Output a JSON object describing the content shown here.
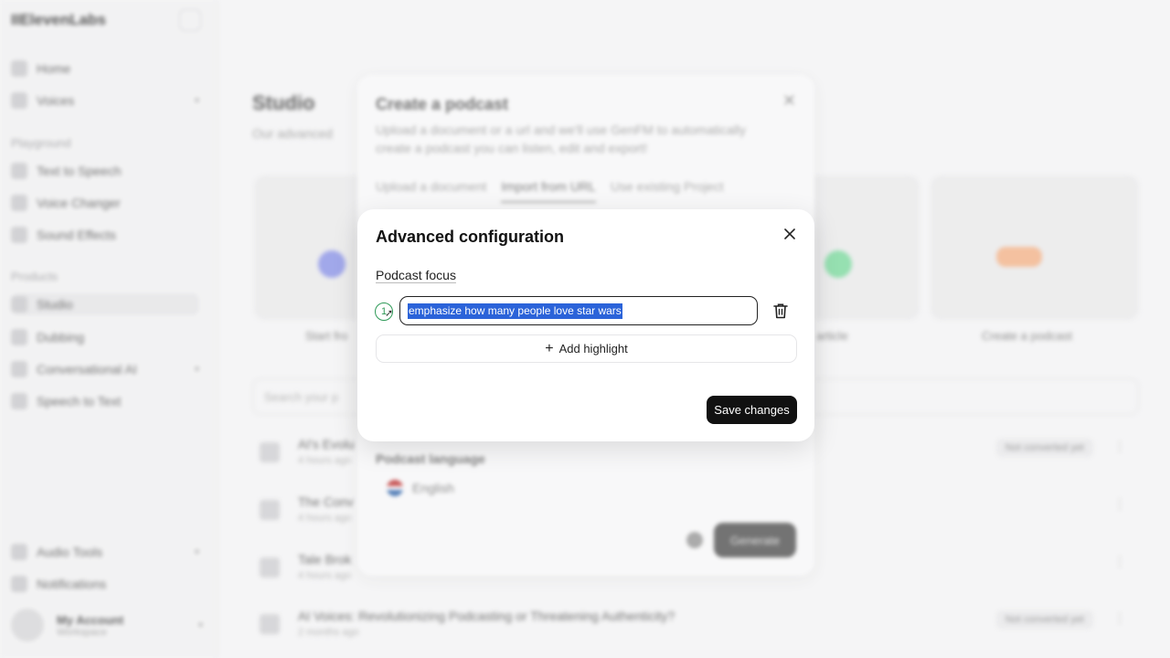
{
  "app": {
    "brand": "IIElevenLabs",
    "nav": [
      {
        "label": "Home"
      },
      {
        "label": "Voices"
      }
    ],
    "section_playground": "Playground",
    "playground": [
      {
        "label": "Text to Speech"
      },
      {
        "label": "Voice Changer"
      },
      {
        "label": "Sound Effects"
      }
    ],
    "section_products": "Products",
    "products": [
      {
        "label": "Studio"
      },
      {
        "label": "Dubbing"
      },
      {
        "label": "Conversational AI"
      },
      {
        "label": "Speech to Text"
      }
    ],
    "bottom": [
      {
        "label": "Audio Tools"
      },
      {
        "label": "Notifications"
      }
    ],
    "account": {
      "name": "My Account",
      "workspace": "Workspace"
    }
  },
  "studio": {
    "title": "Studio",
    "subtitle": "Our advanced",
    "cards": [
      {
        "label": "Start fro"
      },
      {
        "label": "article"
      },
      {
        "label": "Create a podcast"
      }
    ],
    "search_placeholder": "Search your p",
    "rows": [
      {
        "title": "AI's Evolu",
        "sub": "4 hours ago",
        "badge": "Not converted yet"
      },
      {
        "title": "The Conv",
        "sub": "4 hours ago",
        "badge": ""
      },
      {
        "title": "Tale Brok",
        "sub": "4 hours ago",
        "badge": ""
      },
      {
        "title": "AI Voices: Revolutionizing Podcasting or Threatening Authenticity?",
        "sub": "2 months ago",
        "badge": "Not converted yet"
      }
    ]
  },
  "podcast_modal": {
    "title": "Create a podcast",
    "description": "Upload a document or a url and we'll use GenFM to automatically create a podcast you can listen, edit and export!",
    "tabs": [
      "Upload a document",
      "Import from URL",
      "Use existing Project"
    ],
    "language_label": "Podcast language",
    "language_value": "English",
    "generate_label": "Generate"
  },
  "dialog": {
    "title": "Advanced configuration",
    "focus_label": "Podcast focus",
    "highlights": [
      {
        "number": "1",
        "text": "emphasize how many people love star wars"
      }
    ],
    "add_highlight_label": "Add highlight",
    "save_label": "Save changes"
  },
  "colors": {
    "accent_green": "#2f9a58",
    "selection_blue": "#2b63d9",
    "primary_button": "#111111"
  }
}
